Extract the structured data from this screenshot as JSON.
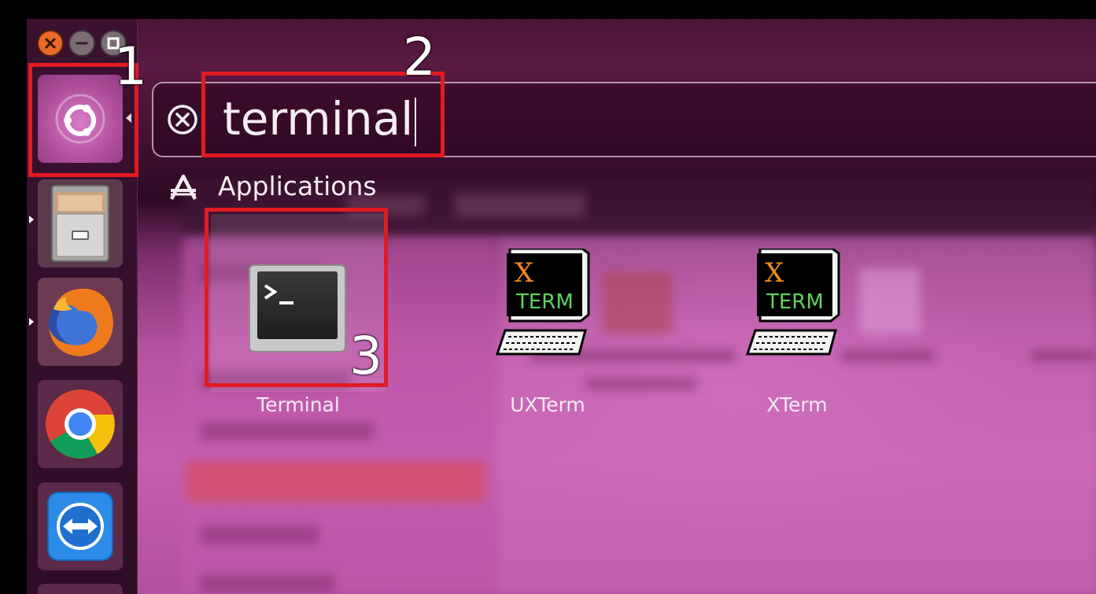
{
  "search": {
    "query": "terminal"
  },
  "results": {
    "category_label": "Applications",
    "apps": [
      {
        "label": "Terminal",
        "icon": "terminal-icon"
      },
      {
        "label": "UXTerm",
        "icon": "xterm-icon"
      },
      {
        "label": "XTerm",
        "icon": "xterm-icon"
      }
    ]
  },
  "xterm_icon_text": {
    "letter": "X",
    "word": "TERM"
  },
  "launcher": {
    "items": [
      {
        "name": "ubuntu-dash",
        "icon": "ubuntu-logo-icon"
      },
      {
        "name": "files",
        "icon": "file-cabinet-icon"
      },
      {
        "name": "firefox",
        "icon": "firefox-icon"
      },
      {
        "name": "chrome",
        "icon": "chrome-icon"
      },
      {
        "name": "teamviewer",
        "icon": "teamviewer-icon"
      }
    ]
  },
  "window_controls": [
    "close-icon",
    "minimize-icon",
    "maximize-icon"
  ],
  "annotations": {
    "step1": "1",
    "step2": "2",
    "step3": "3",
    "highlight_color": "#e11b22"
  },
  "colors": {
    "ubuntu_purple": "#b24f9e",
    "close_orange": "#e86a2b"
  }
}
